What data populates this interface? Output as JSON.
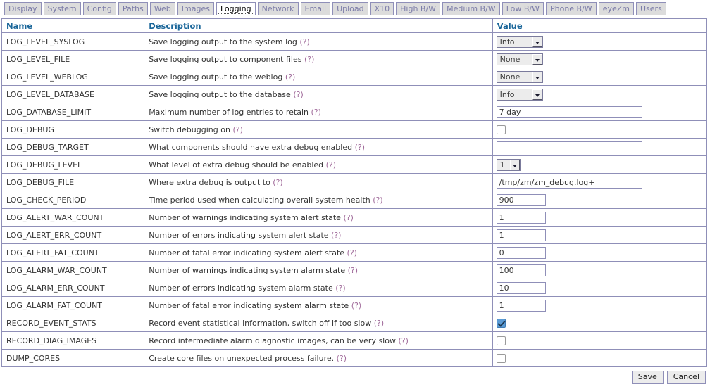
{
  "tabs": [
    {
      "label": "Display",
      "active": false
    },
    {
      "label": "System",
      "active": false
    },
    {
      "label": "Config",
      "active": false
    },
    {
      "label": "Paths",
      "active": false
    },
    {
      "label": "Web",
      "active": false
    },
    {
      "label": "Images",
      "active": false
    },
    {
      "label": "Logging",
      "active": true
    },
    {
      "label": "Network",
      "active": false
    },
    {
      "label": "Email",
      "active": false
    },
    {
      "label": "Upload",
      "active": false
    },
    {
      "label": "X10",
      "active": false
    },
    {
      "label": "High B/W",
      "active": false
    },
    {
      "label": "Medium B/W",
      "active": false
    },
    {
      "label": "Low B/W",
      "active": false
    },
    {
      "label": "Phone B/W",
      "active": false
    },
    {
      "label": "eyeZm",
      "active": false
    },
    {
      "label": "Users",
      "active": false
    }
  ],
  "table": {
    "headers": {
      "name": "Name",
      "description": "Description",
      "value": "Value"
    },
    "hint_label": "(?)",
    "rows": [
      {
        "name": "LOG_LEVEL_SYSLOG",
        "description": "Save logging output to the system log",
        "control": "select",
        "value": "Info",
        "width": "lvl"
      },
      {
        "name": "LOG_LEVEL_FILE",
        "description": "Save logging output to component files",
        "control": "select",
        "value": "None",
        "width": "lvl"
      },
      {
        "name": "LOG_LEVEL_WEBLOG",
        "description": "Save logging output to the weblog",
        "control": "select",
        "value": "None",
        "width": "lvl"
      },
      {
        "name": "LOG_LEVEL_DATABASE",
        "description": "Save logging output to the database",
        "control": "select",
        "value": "Info",
        "width": "lvl"
      },
      {
        "name": "LOG_DATABASE_LIMIT",
        "description": "Maximum number of log entries to retain",
        "control": "text",
        "value": "7 day",
        "width": "wide"
      },
      {
        "name": "LOG_DEBUG",
        "description": "Switch debugging on",
        "control": "checkbox",
        "value": false
      },
      {
        "name": "LOG_DEBUG_TARGET",
        "description": "What components should have extra debug enabled",
        "control": "text",
        "value": "",
        "width": "wide"
      },
      {
        "name": "LOG_DEBUG_LEVEL",
        "description": "What level of extra debug should be enabled",
        "control": "select",
        "value": "1",
        "width": "num"
      },
      {
        "name": "LOG_DEBUG_FILE",
        "description": "Where extra debug is output to",
        "control": "text",
        "value": "/tmp/zm/zm_debug.log+",
        "width": "wide"
      },
      {
        "name": "LOG_CHECK_PERIOD",
        "description": "Time period used when calculating overall system health",
        "control": "text",
        "value": "900",
        "width": "small"
      },
      {
        "name": "LOG_ALERT_WAR_COUNT",
        "description": "Number of warnings indicating system alert state",
        "control": "text",
        "value": "1",
        "width": "small"
      },
      {
        "name": "LOG_ALERT_ERR_COUNT",
        "description": "Number of errors indicating system alert state",
        "control": "text",
        "value": "1",
        "width": "small"
      },
      {
        "name": "LOG_ALERT_FAT_COUNT",
        "description": "Number of fatal error indicating system alert state",
        "control": "text",
        "value": "0",
        "width": "small"
      },
      {
        "name": "LOG_ALARM_WAR_COUNT",
        "description": "Number of warnings indicating system alarm state",
        "control": "text",
        "value": "100",
        "width": "small"
      },
      {
        "name": "LOG_ALARM_ERR_COUNT",
        "description": "Number of errors indicating system alarm state",
        "control": "text",
        "value": "10",
        "width": "small"
      },
      {
        "name": "LOG_ALARM_FAT_COUNT",
        "description": "Number of fatal error indicating system alarm state",
        "control": "text",
        "value": "1",
        "width": "small"
      },
      {
        "name": "RECORD_EVENT_STATS",
        "description": "Record event statistical information, switch off if too slow",
        "control": "checkbox",
        "value": true
      },
      {
        "name": "RECORD_DIAG_IMAGES",
        "description": "Record intermediate alarm diagnostic images, can be very slow",
        "control": "checkbox",
        "value": false
      },
      {
        "name": "DUMP_CORES",
        "description": "Create core files on unexpected process failure.",
        "control": "checkbox",
        "value": false
      }
    ]
  },
  "footer": {
    "save_label": "Save",
    "cancel_label": "Cancel"
  },
  "colors": {
    "header_text": "#1a6699",
    "border": "#8f8fb8",
    "tab_inactive_bg": "#dcdcdc",
    "tab_inactive_text": "#7c7ca8",
    "hint_link": "#a06a9a",
    "checkbox_checked": "#5b9bd5"
  }
}
